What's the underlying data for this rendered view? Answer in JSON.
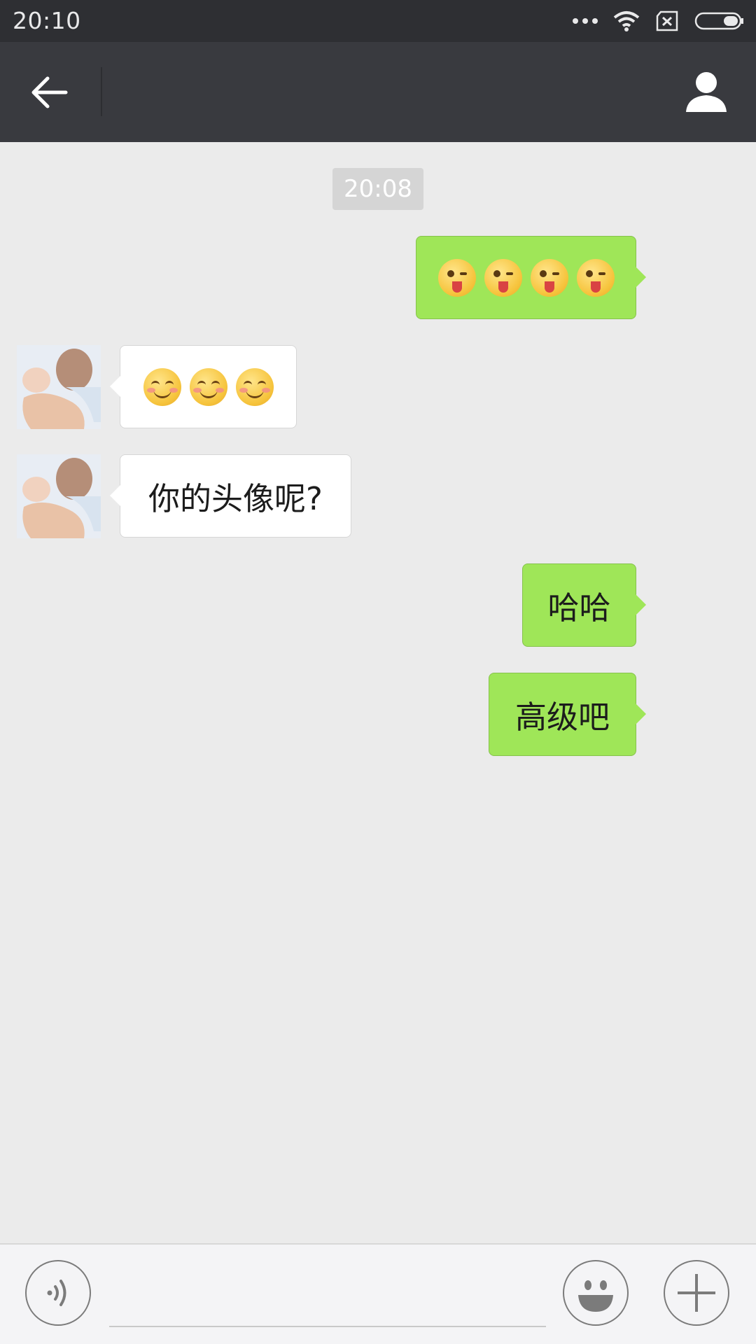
{
  "status_bar": {
    "time": "20:10",
    "icons": [
      "more-dots-icon",
      "wifi-icon",
      "no-sim-icon",
      "battery-icon"
    ]
  },
  "title_bar": {
    "title": "",
    "back_icon": "arrow-left-icon",
    "profile_icon": "person-icon"
  },
  "chat": {
    "timestamp": "20:08",
    "messages": [
      {
        "direction": "out",
        "type": "emoji",
        "emoji": "😜😜😜😜"
      },
      {
        "direction": "in",
        "type": "emoji",
        "emoji": "😊😊😊"
      },
      {
        "direction": "in",
        "type": "text",
        "text": "你的头像呢?"
      },
      {
        "direction": "out",
        "type": "text",
        "text": "哈哈"
      },
      {
        "direction": "out",
        "type": "text",
        "text": "高级吧"
      }
    ]
  },
  "input_bar": {
    "voice_icon": "voice-icon",
    "emoji_icon": "smiley-icon",
    "more_icon": "plus-icon",
    "input_value": ""
  },
  "colors": {
    "status_bar_bg": "#2e2f33",
    "title_bar_bg": "#393a3f",
    "chat_bg": "#ebebeb",
    "outgoing_bubble": "#9fe658",
    "incoming_bubble": "#ffffff",
    "timestamp_bg": "#d5d5d5"
  }
}
